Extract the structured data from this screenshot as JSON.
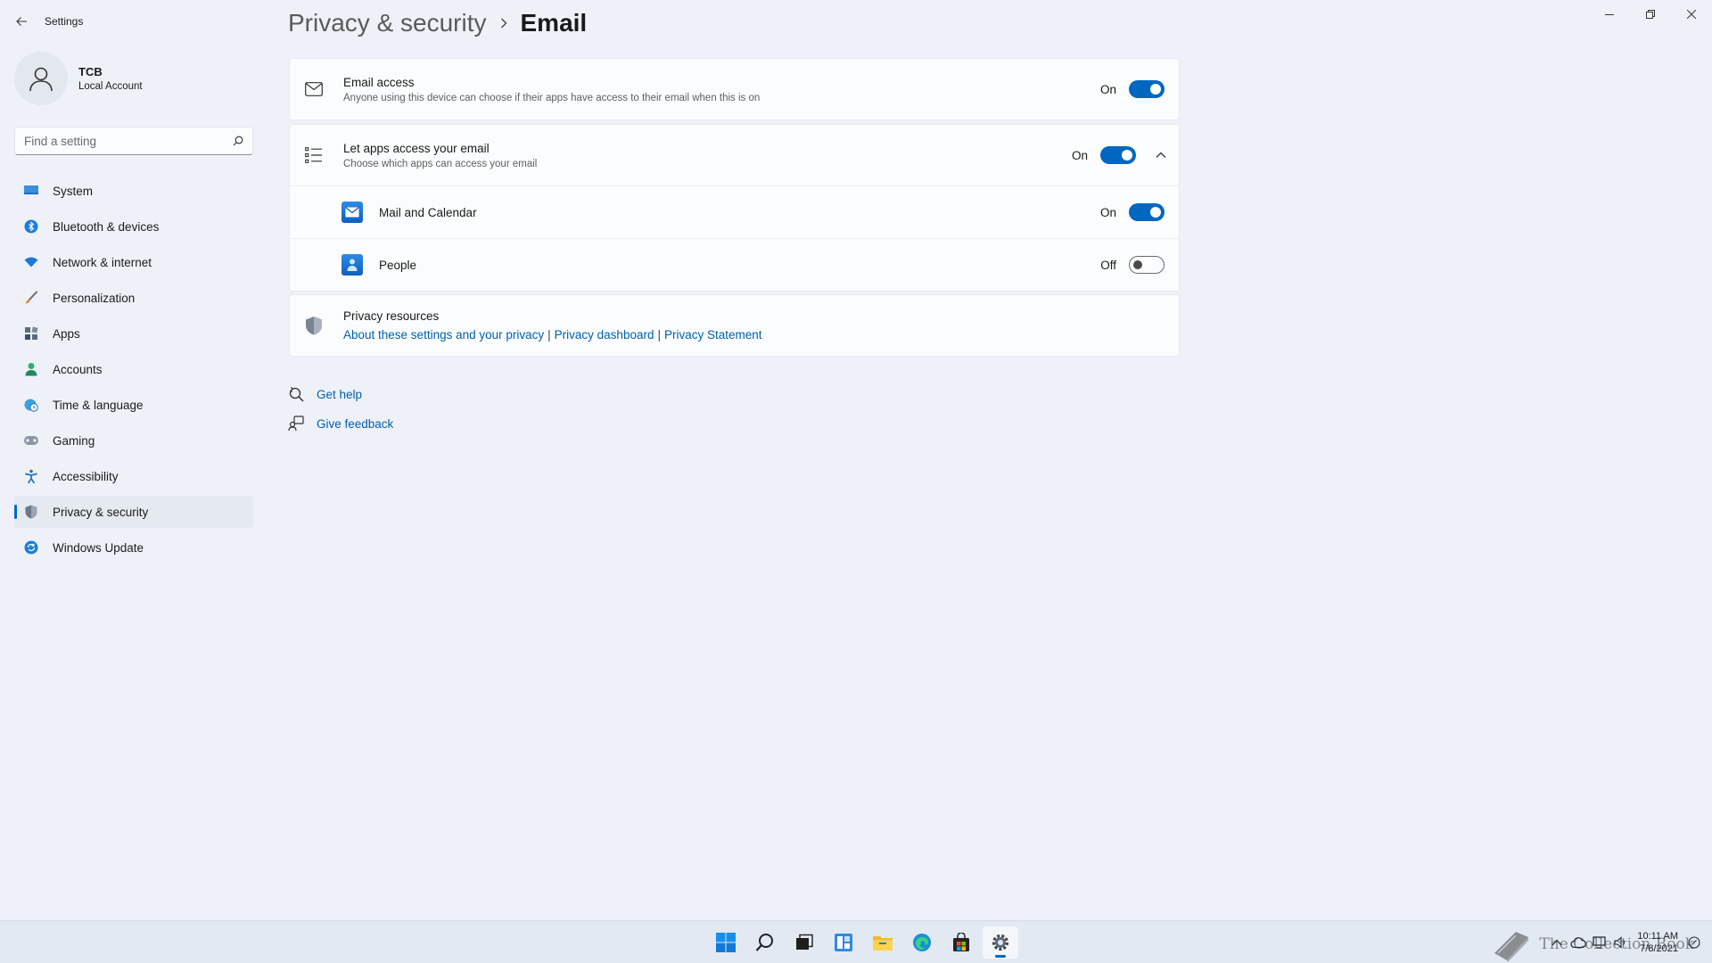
{
  "window": {
    "title": "Settings",
    "controls": [
      "minimize",
      "restore",
      "close"
    ]
  },
  "profile": {
    "name": "TCB",
    "account_type": "Local Account"
  },
  "search": {
    "placeholder": "Find a setting"
  },
  "sidebar": {
    "items": [
      {
        "label": "System",
        "icon": "system-icon",
        "active": false
      },
      {
        "label": "Bluetooth & devices",
        "icon": "bluetooth-icon",
        "active": false
      },
      {
        "label": "Network & internet",
        "icon": "wifi-icon",
        "active": false
      },
      {
        "label": "Personalization",
        "icon": "brush-icon",
        "active": false
      },
      {
        "label": "Apps",
        "icon": "apps-icon",
        "active": false
      },
      {
        "label": "Accounts",
        "icon": "accounts-icon",
        "active": false
      },
      {
        "label": "Time & language",
        "icon": "globe-clock-icon",
        "active": false
      },
      {
        "label": "Gaming",
        "icon": "gamepad-icon",
        "active": false
      },
      {
        "label": "Accessibility",
        "icon": "accessibility-icon",
        "active": false
      },
      {
        "label": "Privacy & security",
        "icon": "shield-icon",
        "active": true
      },
      {
        "label": "Windows Update",
        "icon": "update-icon",
        "active": false
      }
    ]
  },
  "breadcrumb": {
    "parent": "Privacy & security",
    "current": "Email"
  },
  "email_access": {
    "title": "Email access",
    "description": "Anyone using this device can choose if their apps have access to their email when this is on",
    "state": "On",
    "enabled": true
  },
  "apps_access": {
    "title": "Let apps access your email",
    "description": "Choose which apps can access your email",
    "state": "On",
    "enabled": true,
    "expanded": true,
    "apps": [
      {
        "name": "Mail and Calendar",
        "state": "On",
        "enabled": true,
        "icon": "mail-calendar-icon"
      },
      {
        "name": "People",
        "state": "Off",
        "enabled": false,
        "icon": "people-icon"
      }
    ]
  },
  "privacy_resources": {
    "title": "Privacy resources",
    "links": [
      "About these settings and your privacy",
      "Privacy dashboard",
      "Privacy Statement"
    ]
  },
  "help": {
    "get_help": "Get help",
    "give_feedback": "Give feedback"
  },
  "taskbar": {
    "apps": [
      "start-icon",
      "search-icon",
      "task-view-icon",
      "widgets-icon",
      "file-explorer-icon",
      "edge-icon",
      "store-icon",
      "settings-icon"
    ],
    "active_app": "settings-icon",
    "time": "10:11 AM",
    "date": "7/8/2021"
  },
  "watermark": {
    "text": "The Collection Book"
  },
  "colors": {
    "accent": "#0067c0",
    "background": "#eef2f8",
    "card": "#fbfcfd"
  }
}
